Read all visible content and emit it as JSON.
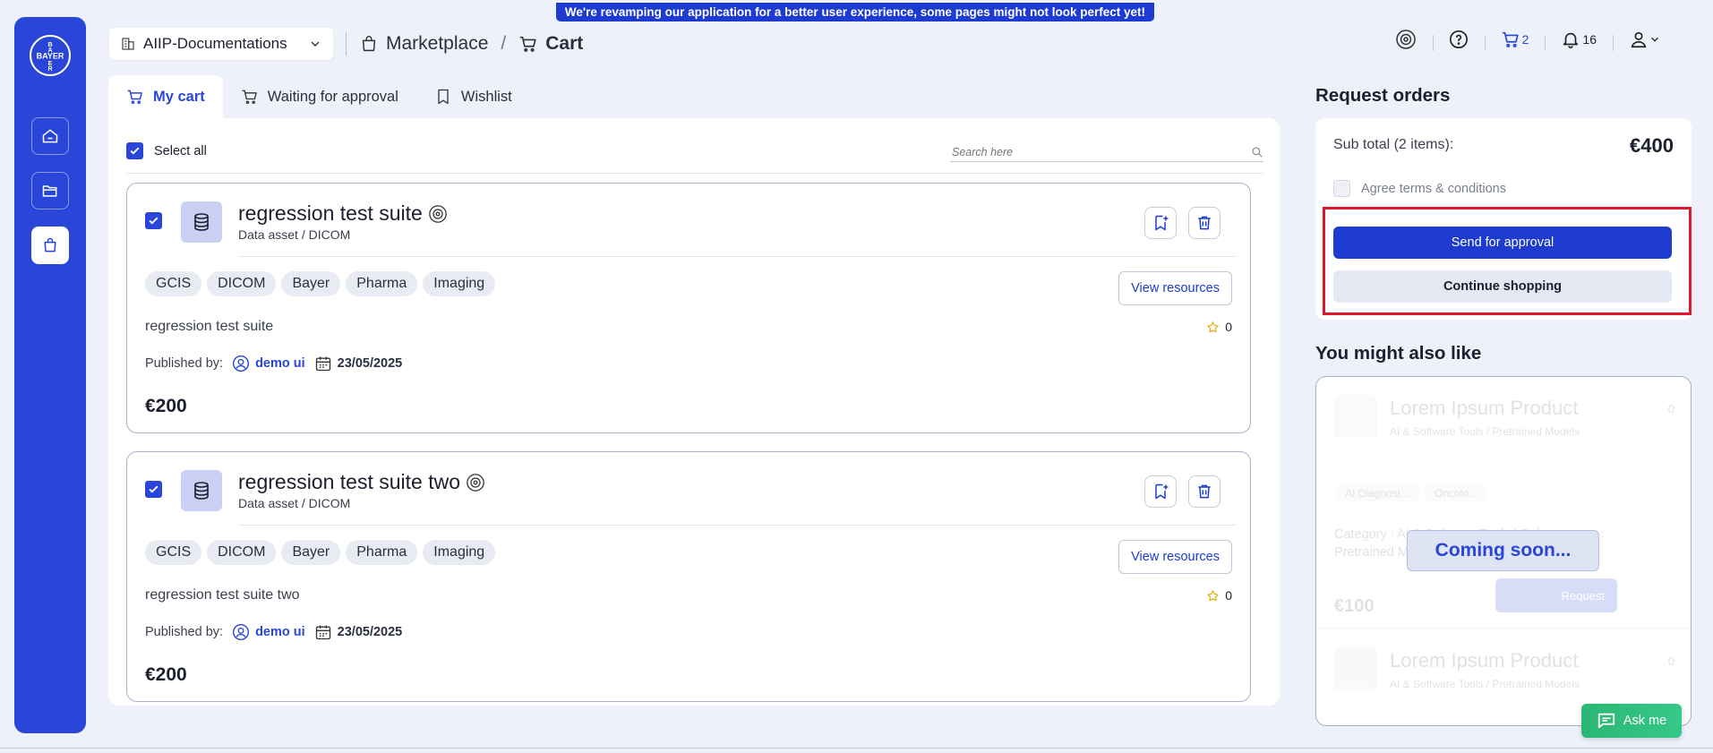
{
  "banner": {
    "text": "We're revamping our application for a better user experience, some pages might not look perfect yet!"
  },
  "sidebar": {
    "logo_text": "BAYER",
    "items": [
      {
        "name": "home"
      },
      {
        "name": "folder"
      },
      {
        "name": "marketplace"
      }
    ]
  },
  "header": {
    "workspace": "AIIP-Documentations",
    "breadcrumb": {
      "parent": "Marketplace",
      "separator": "/",
      "current": "Cart"
    },
    "cart_count": "2",
    "notification_count": "16"
  },
  "tabs": [
    {
      "label": "My cart",
      "active": true
    },
    {
      "label": "Waiting for approval",
      "active": false
    },
    {
      "label": "Wishlist",
      "active": false
    }
  ],
  "cart": {
    "select_all_label": "Select all",
    "search_placeholder": "Search here",
    "items": [
      {
        "title": "regression test suite",
        "subtitle": "Data asset / DICOM",
        "tags": [
          "GCIS",
          "DICOM",
          "Bayer",
          "Pharma",
          "Imaging"
        ],
        "view_label": "View resources",
        "description": "regression test suite",
        "rating": "0",
        "published_label": "Published by:",
        "author": "demo ui",
        "date": "23/05/2025",
        "price": "€200"
      },
      {
        "title": "regression test suite two",
        "subtitle": "Data asset / DICOM",
        "tags": [
          "GCIS",
          "DICOM",
          "Bayer",
          "Pharma",
          "Imaging"
        ],
        "view_label": "View resources",
        "description": "regression test suite two",
        "rating": "0",
        "published_label": "Published by:",
        "author": "demo ui",
        "date": "23/05/2025",
        "price": "€200"
      }
    ]
  },
  "request_orders": {
    "title": "Request orders",
    "subtotal_label": "Sub total (2 items):",
    "subtotal_value": "€400",
    "terms_label": "Agree terms & conditions",
    "send_label": "Send for approval",
    "continue_label": "Continue shopping"
  },
  "you_might_like": {
    "title": "You might also like",
    "products": [
      {
        "title": "Lorem Ipsum Product",
        "subtitle": "AI & Software Tools / Pretrained Models",
        "rating": "0",
        "tags": [
          "AI Diagnost...",
          "Oncolo..."
        ],
        "text": "Category : AI & Software Tools | Sub category : Pretrained Models | Supplier : Bayer",
        "price": "€100",
        "request_label": "Request"
      },
      {
        "title": "Lorem Ipsum Product",
        "subtitle": "AI & Software Tools / Pretrained Models",
        "rating": "0"
      }
    ],
    "coming_soon": "Coming soon..."
  },
  "chat": {
    "label": "Ask me"
  },
  "colors": {
    "primary": "#2a46d8",
    "button": "#1d3bd1",
    "highlight": "#e0172a",
    "chat": "#2bb673"
  }
}
